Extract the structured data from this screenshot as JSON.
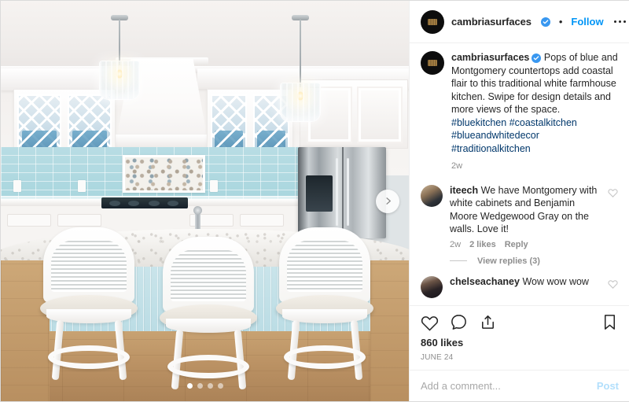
{
  "header": {
    "username": "cambriasurfaces",
    "verified": true,
    "separator": "•",
    "follow_label": "Follow",
    "more_icon": "more-options-icon"
  },
  "caption": {
    "username": "cambriasurfaces",
    "text": "Pops of blue and Montgomery countertops add coastal flair to this traditional white farmhouse kitchen. Swipe for design details and more views of the space.",
    "hashtags": [
      "#bluekitchen",
      "#coastalkitchen",
      "#blueandwhitedecor",
      "#traditionalkitchen"
    ],
    "timestamp": "2w"
  },
  "comments": [
    {
      "username": "iteech",
      "text": "We have Montgomery with white cabinets and Benjamin Moore Wedgewood Gray on the walls. Love it!",
      "timestamp": "2w",
      "likes": "2 likes",
      "reply_label": "Reply",
      "view_replies": "View replies (3)"
    },
    {
      "username": "chelseachaney",
      "text": "Wow wow wow"
    }
  ],
  "actions": {
    "like_icon": "heart-icon",
    "comment_icon": "comment-icon",
    "share_icon": "share-icon",
    "save_icon": "bookmark-icon"
  },
  "likes_count": "860 likes",
  "date": "JUNE 24",
  "add_comment": {
    "placeholder": "Add a comment...",
    "value": "",
    "post_label": "Post"
  },
  "media": {
    "type": "carousel",
    "slide_count": 4,
    "active_slide": 1,
    "next_icon": "chevron-right-icon",
    "alt": "White farmhouse kitchen with light blue beadboard island, marble countertop, glass pendant lights and white bar stools"
  },
  "colors": {
    "accent_blue": "#0095f6",
    "verified_blue": "#3897f0",
    "hashtag_blue": "#00376b",
    "text_primary": "#262626",
    "text_muted": "#8e8e8e",
    "post_disabled": "#b2dffc",
    "border": "#efefef"
  }
}
